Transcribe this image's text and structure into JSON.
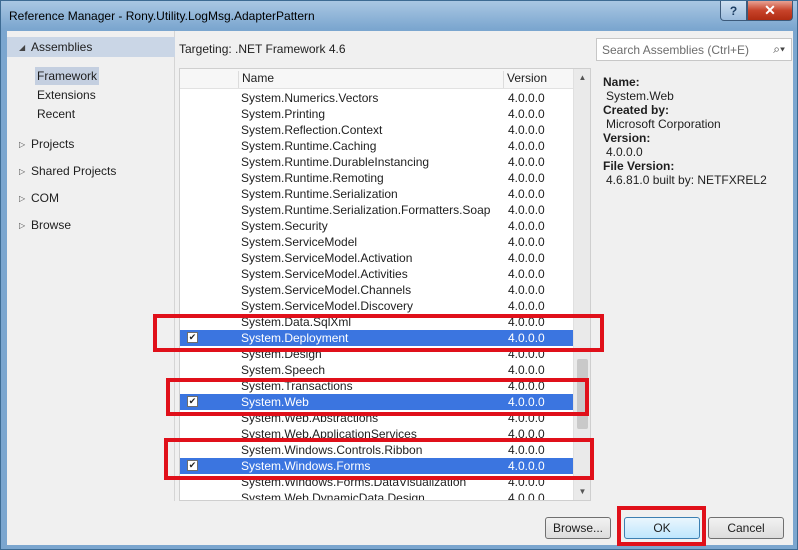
{
  "window": {
    "title": "Reference Manager - Rony.Utility.LogMsg.AdapterPattern",
    "help": "?",
    "close": "✕"
  },
  "nav": {
    "assemblies": "Assemblies",
    "framework": "Framework",
    "extensions": "Extensions",
    "recent": "Recent",
    "projects": "Projects",
    "shared_projects": "Shared Projects",
    "com": "COM",
    "browse": "Browse"
  },
  "targeting": "Targeting: .NET Framework 4.6",
  "search": {
    "placeholder": "Search Assemblies (Ctrl+E)"
  },
  "list": {
    "headers": {
      "name": "Name",
      "version": "Version"
    },
    "rows": [
      {
        "name": "System.Numerics.Vectors",
        "version": "4.0.0.0"
      },
      {
        "name": "System.Printing",
        "version": "4.0.0.0"
      },
      {
        "name": "System.Reflection.Context",
        "version": "4.0.0.0"
      },
      {
        "name": "System.Runtime.Caching",
        "version": "4.0.0.0"
      },
      {
        "name": "System.Runtime.DurableInstancing",
        "version": "4.0.0.0"
      },
      {
        "name": "System.Runtime.Remoting",
        "version": "4.0.0.0"
      },
      {
        "name": "System.Runtime.Serialization",
        "version": "4.0.0.0"
      },
      {
        "name": "System.Runtime.Serialization.Formatters.Soap",
        "version": "4.0.0.0"
      },
      {
        "name": "System.Security",
        "version": "4.0.0.0"
      },
      {
        "name": "System.ServiceModel",
        "version": "4.0.0.0"
      },
      {
        "name": "System.ServiceModel.Activation",
        "version": "4.0.0.0"
      },
      {
        "name": "System.ServiceModel.Activities",
        "version": "4.0.0.0"
      },
      {
        "name": "System.ServiceModel.Channels",
        "version": "4.0.0.0"
      },
      {
        "name": "System.ServiceModel.Discovery",
        "version": "4.0.0.0"
      },
      {
        "name": "System.Data.SqlXml",
        "version": "4.0.0.0"
      },
      {
        "name": "System.Deployment",
        "version": "4.0.0.0",
        "selected": true,
        "checked": true
      },
      {
        "name": "System.Design",
        "version": "4.0.0.0"
      },
      {
        "name": "System.Speech",
        "version": "4.0.0.0"
      },
      {
        "name": "System.Transactions",
        "version": "4.0.0.0"
      },
      {
        "name": "System.Web",
        "version": "4.0.0.0",
        "selected": true,
        "checked": true
      },
      {
        "name": "System.Web.Abstractions",
        "version": "4.0.0.0"
      },
      {
        "name": "System.Web.ApplicationServices",
        "version": "4.0.0.0"
      },
      {
        "name": "System.Windows.Controls.Ribbon",
        "version": "4.0.0.0"
      },
      {
        "name": "System.Windows.Forms",
        "version": "4.0.0.0",
        "selected": true,
        "checked": true
      },
      {
        "name": "System.Windows.Forms.DataVisualization",
        "version": "4.0.0.0"
      },
      {
        "name": "System.Web.DynamicData.Design",
        "version": "4.0.0.0"
      }
    ]
  },
  "details": {
    "name_label": "Name:",
    "name_value": "System.Web",
    "created_label": "Created by:",
    "created_value": "Microsoft Corporation",
    "version_label": "Version:",
    "version_value": "4.0.0.0",
    "file_version_label": "File Version:",
    "file_version_value": "4.6.81.0 built by: NETFXREL2"
  },
  "buttons": {
    "browse": "Browse...",
    "ok": "OK",
    "cancel": "Cancel"
  },
  "colors": {
    "selection": "#3b75e0",
    "annotation": "#e0101a"
  }
}
